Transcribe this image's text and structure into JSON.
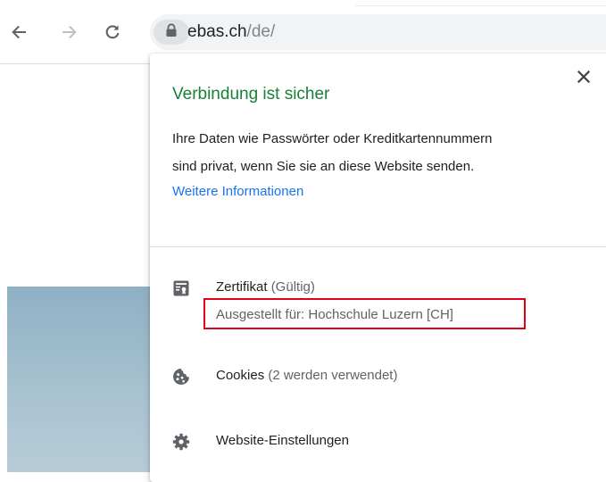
{
  "browser": {
    "url_host": "ebas.ch",
    "url_path": "/de/",
    "back_icon": "arrow-left-icon",
    "forward_icon": "arrow-right-icon",
    "reload_icon": "reload-icon",
    "lock_icon": "lock-icon"
  },
  "page_info": {
    "title": "Verbindung ist sicher",
    "description_line1": "Ihre Daten wie Passwörter oder Kreditkartennummern",
    "description_line2": "sind privat, wenn Sie sie an diese Website senden.",
    "more_info_link": "Weitere Informationen",
    "close_icon": "close-icon",
    "certificate": {
      "label": "Zertifikat",
      "status": "(Gültig)",
      "issued_to": "Ausgestellt für: Hochschule Luzern [CH]",
      "icon": "certificate-icon"
    },
    "cookies": {
      "label": "Cookies",
      "status": "(2 werden verwendet)",
      "icon": "cookie-icon"
    },
    "site_settings": {
      "label": "Website-Einstellungen",
      "icon": "gear-icon"
    }
  },
  "colors": {
    "secure_green": "#188038",
    "link_blue": "#1a73e8",
    "highlight_red": "#e3001b",
    "icon_gray": "#5f6368"
  }
}
